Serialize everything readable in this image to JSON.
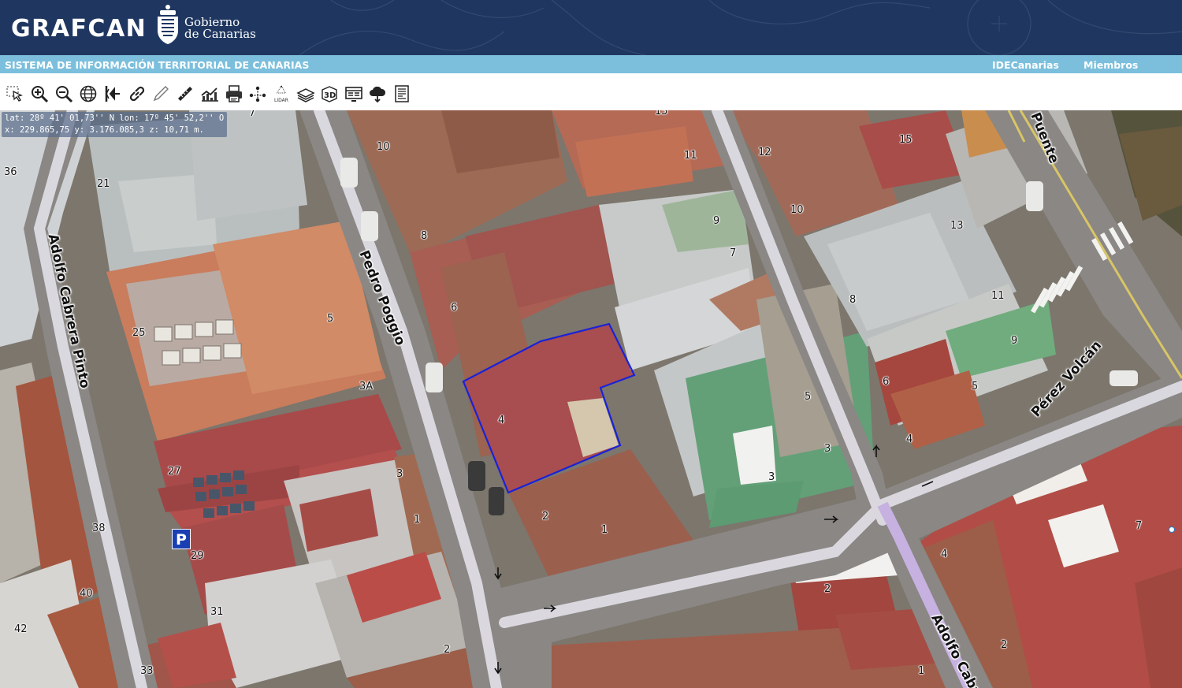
{
  "header": {
    "brand": "GRAFCAN",
    "gov_line1": "Gobierno",
    "gov_line2": "de Canarias",
    "bg_color": "#1f3760"
  },
  "infobar": {
    "title": "SISTEMA DE INFORMACIÓN TERRITORIAL DE CANARIAS",
    "link_ide": "IDECanarias",
    "link_members": "Miembros SITCAN",
    "bg_color": "#7bbfdc"
  },
  "toolbar": {
    "tools": [
      {
        "icon": "select-arrow-icon"
      },
      {
        "icon": "zoom-in-icon"
      },
      {
        "icon": "zoom-out-icon"
      },
      {
        "icon": "globe-icon"
      },
      {
        "icon": "exit-icon"
      },
      {
        "icon": "link-icon"
      },
      {
        "icon": "pencil-icon"
      },
      {
        "icon": "ruler-icon"
      },
      {
        "icon": "profile-chart-icon"
      },
      {
        "icon": "print-icon"
      },
      {
        "icon": "network-icon"
      },
      {
        "icon": "lidar-icon",
        "label": "LIDAR"
      },
      {
        "icon": "layers-icon"
      },
      {
        "icon": "3d-icon",
        "label": "3D"
      },
      {
        "icon": "viewer-icon"
      },
      {
        "icon": "download-cloud-icon"
      },
      {
        "icon": "document-icon"
      }
    ]
  },
  "map": {
    "coords_line1": "lat: 28º 41' 01,73'' N  lon: 17º 45' 52,2'' O",
    "coords_line2": "x: 229.865,75  y: 3.176.085,3  z: 10,71 m.",
    "selection_color": "#1a22d8",
    "parking_label": "P",
    "streets": [
      {
        "id": "adolfo-cabrera-pinto-west",
        "name": "Adolfo Cabrera Pinto"
      },
      {
        "id": "pedro-poggio",
        "name": "Pedro Poggio"
      },
      {
        "id": "perez-volcan",
        "name": "Pérez Volcán"
      },
      {
        "id": "puente",
        "name": "Puente"
      },
      {
        "id": "adolfo-cabrera-south",
        "name": "Adolfo Cabre"
      }
    ],
    "house_numbers": [
      "7",
      "36",
      "21",
      "10",
      "8",
      "15",
      "11",
      "12",
      "15",
      "10",
      "9",
      "7",
      "13",
      "8",
      "11",
      "9",
      "6",
      "5",
      "25",
      "3A",
      "4",
      "5",
      "3",
      "6",
      "5",
      "4",
      "27",
      "3",
      "38",
      "2",
      "1",
      "1",
      "29",
      "31",
      "40",
      "42",
      "2",
      "33",
      "2",
      "4",
      "2",
      "7",
      "1",
      "3"
    ]
  }
}
